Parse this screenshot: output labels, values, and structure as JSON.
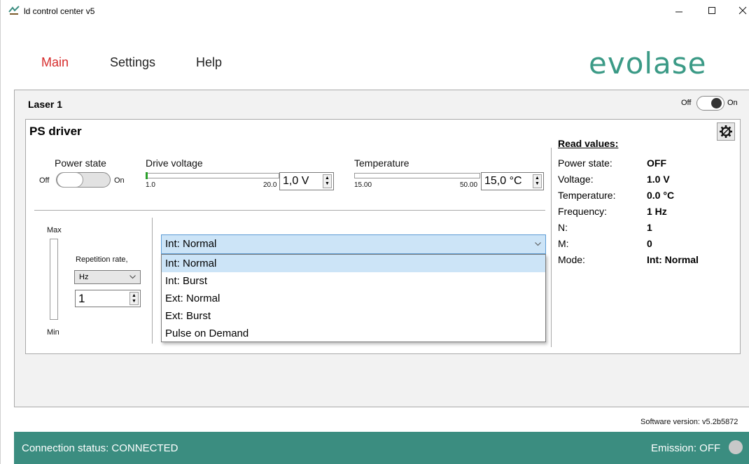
{
  "window": {
    "title": "ld control center v5",
    "icon": "app-logo-icon",
    "controls": [
      "minimize-icon",
      "maximize-icon",
      "close-icon"
    ]
  },
  "menu": {
    "items": [
      {
        "label": "Main",
        "active": true
      },
      {
        "label": "Settings",
        "active": false
      },
      {
        "label": "Help",
        "active": false
      }
    ]
  },
  "brand": {
    "logo_text": "evolase",
    "color": "#3b9a86"
  },
  "laser": {
    "title": "Laser 1",
    "toggle": {
      "off_label": "Off",
      "on_label": "On"
    }
  },
  "ps_driver": {
    "title": "PS driver",
    "settings_icon": "gear-icon",
    "power_state": {
      "label": "Power state",
      "off_label": "Off",
      "on_label": "On"
    },
    "drive_voltage": {
      "label": "Drive voltage",
      "min": "1.0",
      "max": "20.0",
      "value": "1,0 V",
      "fraction": 0.0
    },
    "temperature": {
      "label": "Temperature",
      "min": "15.00",
      "max": "50.00",
      "value": "15,0 °C",
      "fraction": 0.0
    },
    "meter": {
      "max_label": "Max",
      "min_label": "Min"
    },
    "repetition": {
      "label": "Repetition rate,",
      "unit": "Hz",
      "value": "1"
    },
    "mode": {
      "selected": "Int: Normal",
      "options": [
        "Int: Normal",
        "Int: Burst",
        "Ext: Normal",
        "Ext: Burst",
        "Pulse on Demand"
      ]
    },
    "read_values": {
      "title": "Read values:",
      "rows": [
        {
          "label": "Power state:",
          "value": "OFF"
        },
        {
          "label": "Voltage:",
          "value": "1.0 V"
        },
        {
          "label": "Temperature:",
          "value": "0.0 °C"
        },
        {
          "label": "Frequency:",
          "value": "1 Hz"
        },
        {
          "label": "N:",
          "value": "1"
        },
        {
          "label": "M:",
          "value": "0"
        },
        {
          "label": "Mode:",
          "value": "Int: Normal"
        }
      ]
    }
  },
  "footer": {
    "version": "Software version: v5.2b5872",
    "connection": "Connection status: CONNECTED",
    "emission": "Emission: OFF",
    "status_color": "#3b8d80"
  }
}
